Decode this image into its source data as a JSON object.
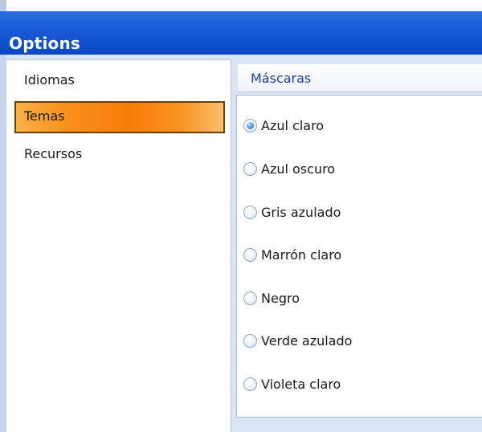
{
  "window": {
    "title": "Options"
  },
  "nav": {
    "items": [
      {
        "label": "Idiomas",
        "selected": false
      },
      {
        "label": "Temas",
        "selected": true
      },
      {
        "label": "Recursos",
        "selected": false
      }
    ]
  },
  "content": {
    "section_title": "Máscaras",
    "options": [
      {
        "label": "Azul claro",
        "checked": true
      },
      {
        "label": "Azul oscuro",
        "checked": false
      },
      {
        "label": "Gris azulado",
        "checked": false
      },
      {
        "label": "Marrón claro",
        "checked": false
      },
      {
        "label": "Negro",
        "checked": false
      },
      {
        "label": "Verde azulado",
        "checked": false
      },
      {
        "label": "Violeta claro",
        "checked": false
      }
    ]
  },
  "colors": {
    "titlebar": "#1a5cd8",
    "selection_orange": "#f77d08",
    "header_text": "#1c3f8f",
    "panel_bg": "#d9e4f5"
  }
}
